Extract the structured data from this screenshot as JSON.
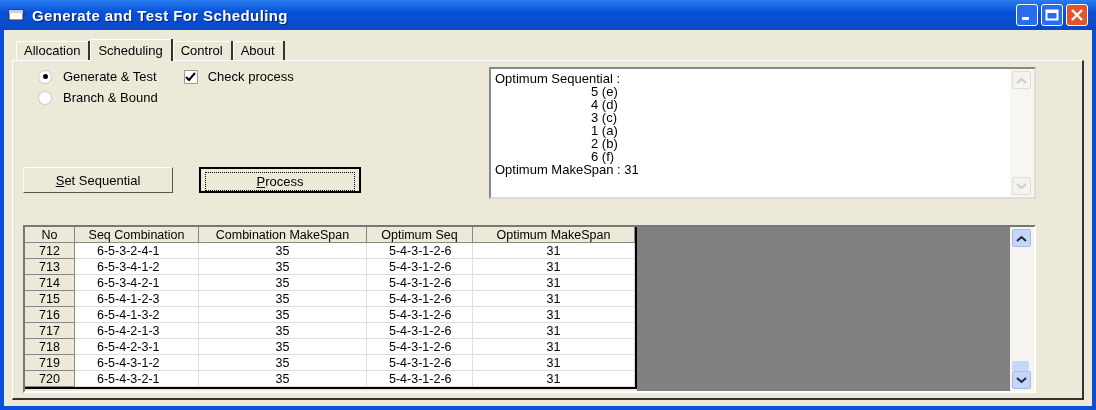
{
  "window": {
    "title": "Generate and Test For Scheduling"
  },
  "tabs": [
    {
      "label": "Allocation",
      "selected": false
    },
    {
      "label": "Scheduling",
      "selected": true
    },
    {
      "label": "Control",
      "selected": false
    },
    {
      "label": "About",
      "selected": false
    }
  ],
  "methods": [
    {
      "label": "Generate & Test",
      "selected": true
    },
    {
      "label": "Branch & Bound",
      "selected": false
    }
  ],
  "check_process": {
    "label": "Check process",
    "checked": true
  },
  "buttons": [
    {
      "label": "Set Sequential",
      "underline_first": true,
      "focused": false
    },
    {
      "label": "Process",
      "underline_first": true,
      "focused": true
    }
  ],
  "output": {
    "lines": [
      {
        "kind": "heading",
        "text": "Optimum Sequential :"
      },
      {
        "kind": "item",
        "text": "5 (e)"
      },
      {
        "kind": "item",
        "text": "4 (d)"
      },
      {
        "kind": "item",
        "text": "3 (c)"
      },
      {
        "kind": "item",
        "text": "1 (a)"
      },
      {
        "kind": "item",
        "text": "2 (b)"
      },
      {
        "kind": "item",
        "text": "6 (f)"
      },
      {
        "kind": "heading",
        "text": "Optimum MakeSpan : 31"
      }
    ]
  },
  "table": {
    "columns": [
      "No",
      "Seq Combination",
      "Combination MakeSpan",
      "Optimum Seq",
      "Optimum MakeSpan"
    ],
    "rows": [
      [
        "712",
        "6-5-3-2-4-1",
        "35",
        "5-4-3-1-2-6",
        "31"
      ],
      [
        "713",
        "6-5-3-4-1-2",
        "35",
        "5-4-3-1-2-6",
        "31"
      ],
      [
        "714",
        "6-5-3-4-2-1",
        "35",
        "5-4-3-1-2-6",
        "31"
      ],
      [
        "715",
        "6-5-4-1-2-3",
        "35",
        "5-4-3-1-2-6",
        "31"
      ],
      [
        "716",
        "6-5-4-1-3-2",
        "35",
        "5-4-3-1-2-6",
        "31"
      ],
      [
        "717",
        "6-5-4-2-1-3",
        "35",
        "5-4-3-1-2-6",
        "31"
      ],
      [
        "718",
        "6-5-4-2-3-1",
        "35",
        "5-4-3-1-2-6",
        "31"
      ],
      [
        "719",
        "6-5-4-3-1-2",
        "35",
        "5-4-3-1-2-6",
        "31"
      ],
      [
        "720",
        "6-5-4-3-2-1",
        "35",
        "5-4-3-1-2-6",
        "31"
      ]
    ]
  }
}
